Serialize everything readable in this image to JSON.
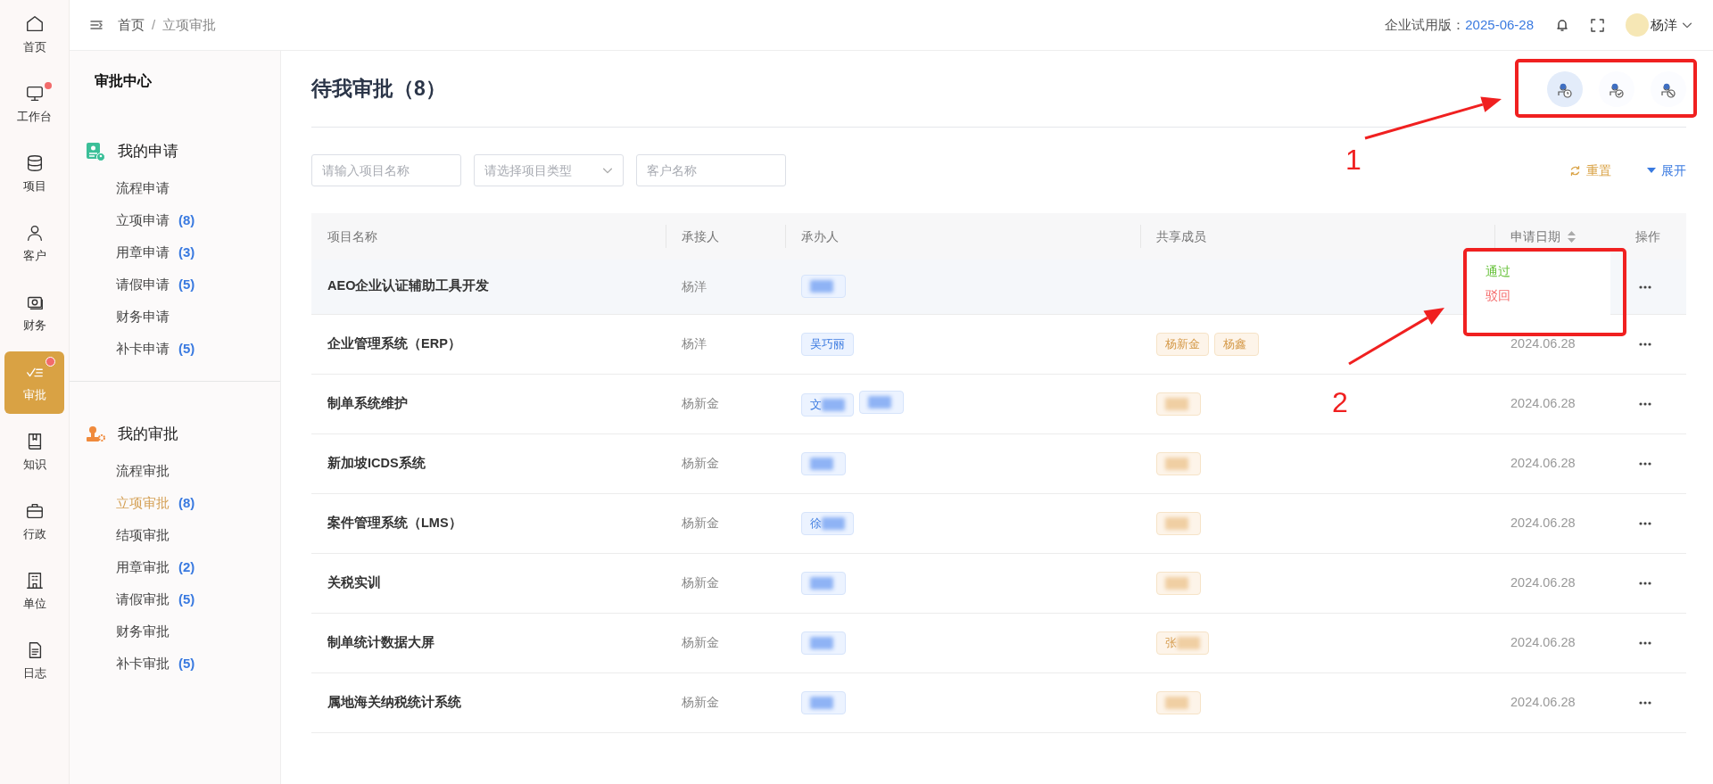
{
  "nav_rail": [
    {
      "label": "首页",
      "selected": false,
      "dot": false
    },
    {
      "label": "工作台",
      "selected": false,
      "dot": true
    },
    {
      "label": "项目",
      "selected": false,
      "dot": false
    },
    {
      "label": "客户",
      "selected": false,
      "dot": false
    },
    {
      "label": "财务",
      "selected": false,
      "dot": false
    },
    {
      "label": "审批",
      "selected": true,
      "dot": true
    },
    {
      "label": "知识",
      "selected": false,
      "dot": false
    },
    {
      "label": "行政",
      "selected": false,
      "dot": false
    },
    {
      "label": "单位",
      "selected": false,
      "dot": false
    },
    {
      "label": "日志",
      "selected": false,
      "dot": false
    }
  ],
  "breadcrumb": {
    "separator": "/",
    "items": [
      "首页",
      "立项审批"
    ]
  },
  "topbar": {
    "edition_label": "企业试用版：",
    "edition_date": "2025-06-28",
    "user": "杨洋"
  },
  "sidebar": {
    "title": "审批中心",
    "groups": [
      {
        "kind": "apply",
        "title": "我的申请",
        "items": [
          {
            "label": "流程申请",
            "selected": false
          },
          {
            "label": "立项申请",
            "count": "(8)",
            "selected": false
          },
          {
            "label": "用章申请",
            "count": "(3)",
            "selected": false
          },
          {
            "label": "请假申请",
            "count": "(5)",
            "selected": false
          },
          {
            "label": "财务申请",
            "selected": false
          },
          {
            "label": "补卡申请",
            "count": "(5)",
            "selected": false
          }
        ]
      },
      {
        "kind": "approve",
        "title": "我的审批",
        "items": [
          {
            "label": "流程审批",
            "selected": false
          },
          {
            "label": "立项审批",
            "count": "(8)",
            "selected": true
          },
          {
            "label": "结项审批",
            "selected": false
          },
          {
            "label": "用章审批",
            "count": "(2)",
            "selected": false
          },
          {
            "label": "请假审批",
            "count": "(5)",
            "selected": false
          },
          {
            "label": "财务审批",
            "selected": false
          },
          {
            "label": "补卡审批",
            "count": "(5)",
            "selected": false
          }
        ]
      }
    ]
  },
  "page": {
    "title": "待我审批（8）",
    "view_buttons": [
      {
        "kind": "pending",
        "selected": true
      },
      {
        "kind": "approved",
        "selected": false
      },
      {
        "kind": "rejected",
        "selected": false
      }
    ]
  },
  "filters": [
    {
      "kind": "text",
      "placeholder": "请输入项目名称"
    },
    {
      "kind": "select",
      "placeholder": "请选择项目类型"
    },
    {
      "kind": "text",
      "placeholder": "客户名称"
    }
  ],
  "filter_actions": [
    {
      "kind": "reset",
      "label": "重置"
    },
    {
      "kind": "expand",
      "label": "展开"
    }
  ],
  "table": {
    "columns": [
      "项目名称",
      "承接人",
      "承办人",
      "共享成员",
      "申请日期",
      "操作"
    ],
    "rows": [
      {
        "name": "AEO企业认证辅助工具开发",
        "receiver": "杨洋",
        "handlers": [
          {
            "blurred": true
          }
        ],
        "members": [],
        "highlighted": true,
        "menu": [
          {
            "kind": "approve",
            "label": "通过"
          },
          {
            "kind": "reject",
            "label": "驳回"
          }
        ]
      },
      {
        "name": "企业管理系统（ERP）",
        "receiver": "杨洋",
        "handlers": [
          {
            "text": "吴巧丽",
            "blurred": false
          }
        ],
        "members": [
          {
            "text": "杨新金",
            "blurred": false
          },
          {
            "text": "杨鑫",
            "blurred": false
          }
        ],
        "date": "2024.06.28",
        "highlighted": false
      },
      {
        "name": "制单系统维护",
        "receiver": "杨新金",
        "handlers": [
          {
            "text": "文",
            "blurred": true
          },
          {
            "blurred": true
          }
        ],
        "members": [
          {
            "blurred": true
          }
        ],
        "date": "2024.06.28",
        "highlighted": false
      },
      {
        "name": "新加坡ICDS系统",
        "receiver": "杨新金",
        "handlers": [
          {
            "blurred": true
          }
        ],
        "members": [
          {
            "blurred": true
          }
        ],
        "date": "2024.06.28",
        "highlighted": false
      },
      {
        "name": "案件管理系统（LMS）",
        "receiver": "杨新金",
        "handlers": [
          {
            "text": "徐",
            "blurred": true
          }
        ],
        "members": [
          {
            "blurred": true
          }
        ],
        "date": "2024.06.28",
        "highlighted": false
      },
      {
        "name": "关税实训",
        "receiver": "杨新金",
        "handlers": [
          {
            "blurred": true
          }
        ],
        "members": [
          {
            "blurred": true
          }
        ],
        "date": "2024.06.28",
        "highlighted": false
      },
      {
        "name": "制单统计数据大屏",
        "receiver": "杨新金",
        "handlers": [
          {
            "blurred": true
          }
        ],
        "members": [
          {
            "text": "张",
            "blurred": true
          }
        ],
        "date": "2024.06.28",
        "highlighted": false
      },
      {
        "name": "属地海关纳税统计系统",
        "receiver": "杨新金",
        "handlers": [
          {
            "blurred": true
          }
        ],
        "members": [
          {
            "blurred": true
          }
        ],
        "date": "2024.06.28",
        "highlighted": false
      }
    ]
  },
  "annotations": [
    {
      "label": "1"
    },
    {
      "label": "2"
    }
  ]
}
